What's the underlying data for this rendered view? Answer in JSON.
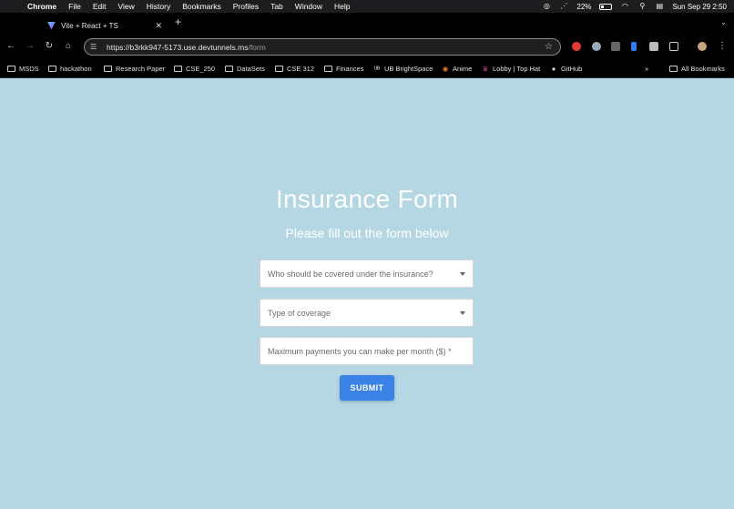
{
  "menubar": {
    "app": "Chrome",
    "items": [
      "File",
      "Edit",
      "View",
      "History",
      "Bookmarks",
      "Profiles",
      "Tab",
      "Window",
      "Help"
    ],
    "battery": "22%",
    "datetime": "Sun Sep 29  2:50"
  },
  "tab": {
    "title": "Vite + React + TS",
    "close": "✕",
    "new": "+"
  },
  "toolbar": {
    "url_host": "https://b3rkk947-5173.use.devtunnels.ms",
    "url_path": "/form"
  },
  "bookmarks": {
    "items": [
      "MSDS",
      "hackathon",
      "Research Paper",
      "CSE_250",
      "DataSets",
      "CSE 312",
      "Finances",
      "UB BrightSpace",
      "Anime",
      "Lobby | Top Hat",
      "GitHub"
    ],
    "overflow": "»",
    "all": "All Bookmarks"
  },
  "form": {
    "title": "Insurance Form",
    "subtitle": "Please fill out the form below",
    "covered_placeholder": "Who should be covered under the insurance?",
    "coverage_placeholder": "Type of coverage",
    "payment_placeholder": "Maximum payments you can make per month ($) *",
    "submit_label": "SUBMIT"
  },
  "colors": {
    "page_bg": "#b5d7e4",
    "accent": "#3b82e6"
  }
}
